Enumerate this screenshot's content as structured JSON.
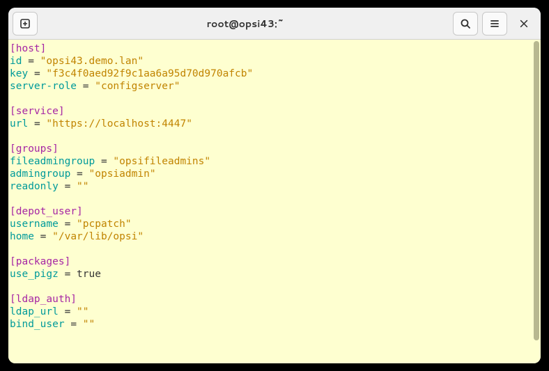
{
  "titlebar": {
    "title": "root@opsi43:~"
  },
  "config": {
    "host": {
      "section": "[host]",
      "id_key": "id",
      "id_val": "\"opsi43.demo.lan\"",
      "key_key": "key",
      "key_val": "\"f3c4f0aed92f9c1aa6a95d70d970afcb\"",
      "role_key": "server-role",
      "role_val": "\"configserver\""
    },
    "service": {
      "section": "[service]",
      "url_key": "url",
      "url_val": "\"https://localhost:4447\""
    },
    "groups": {
      "section": "[groups]",
      "fileadmin_key": "fileadmingroup",
      "fileadmin_val": "\"opsifileadmins\"",
      "admin_key": "admingroup",
      "admin_val": "\"opsiadmin\"",
      "readonly_key": "readonly",
      "readonly_val": "\"\""
    },
    "depot_user": {
      "section": "[depot_user]",
      "username_key": "username",
      "username_val": "\"pcpatch\"",
      "home_key": "home",
      "home_val": "\"/var/lib/opsi\""
    },
    "packages": {
      "section": "[packages]",
      "pigz_key": "use_pigz",
      "pigz_val": "true"
    },
    "ldap_auth": {
      "section": "[ldap_auth]",
      "url_key": "ldap_url",
      "url_val": "\"\"",
      "bind_key": "bind_user",
      "bind_val": "\"\""
    }
  }
}
